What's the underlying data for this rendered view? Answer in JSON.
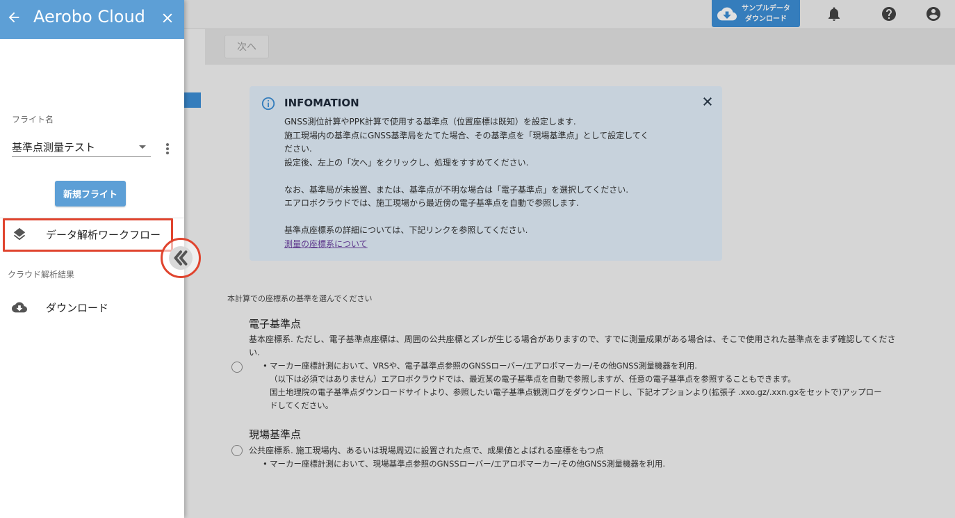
{
  "topbar": {
    "sample_download_label_line1": "サンプルデータ",
    "sample_download_label_line2": "ダウンロード"
  },
  "toolbar": {
    "next_label": "次へ"
  },
  "info": {
    "title": "INFOMATION",
    "lines": [
      "GNSS測位計算やPPK計算で使用する基準点（位置座標は既知）を設定します.",
      "施工現場内の基準点にGNSS基準局をたてた場合、その基準点を「現場基準点」として設定してく",
      "ださい.",
      "設定後、左上の「次へ」をクリックし、処理をすすめてください.",
      "なお、基準局が未設置、または、基準点が不明な場合は「電子基準点」を選択してください.",
      "エアロボクラウドでは、施工現場から最近傍の電子基準点を自動で参照します.",
      "基準点座標系の詳細については、下記リンクを参照してください."
    ],
    "link_label": "測量の座標系について"
  },
  "selection": {
    "section_label": "本計算での座標系の基準を選んでください",
    "options": [
      {
        "title": "電子基準点",
        "desc": "基本座標系. ただし、電子基準点座標は、周囲の公共座標とズレが生じる場合がありますので、すでに測量成果がある場合は、そこで使用された基準点をまず確認してくださ",
        "desc_cont": "い.",
        "bullet": "マーカー座標計測において、VRSや、電子基準点参照のGNSSローバー/エアロボマーカー/その他GNSS測量機器を利用.",
        "sub1": "（以下は必須ではありません）エアロボクラウドでは、最近某の電子基準点を自動で参照しますが、任意の電子基準点を参照することもできます。",
        "sub2": "国土地理院の電子基準点ダウンロードサイトより、参照したい電子基準点観測ログをダウンロードし、下記オプションより(拡張子 .xxo.gz/.xxn.gxをセットで)アップロー",
        "sub3": "ドしてください。"
      },
      {
        "title": "現場基準点",
        "desc": "公共座標系. 施工現場内、あるいは現場周辺に設置された点で、成果値とよばれる座標をもつ点",
        "bullet": "マーカー座標計測において、現場基準点参照のGNSSローバー/エアロボマーカー/その他GNSS測量機器を利用."
      }
    ]
  },
  "drawer": {
    "title": "Aerobo Cloud",
    "flight_label": "フライト名",
    "flight_value": "基準点測量テスト",
    "new_flight_label": "新規フライト",
    "nav_workflow_label": "データ解析ワークフロー",
    "group_label": "クラウド解析結果",
    "nav_download_label": "ダウンロード"
  },
  "colors": {
    "accent": "#5d9fd6",
    "highlight": "#e0442e",
    "info_bg": "#e3f0fb"
  }
}
